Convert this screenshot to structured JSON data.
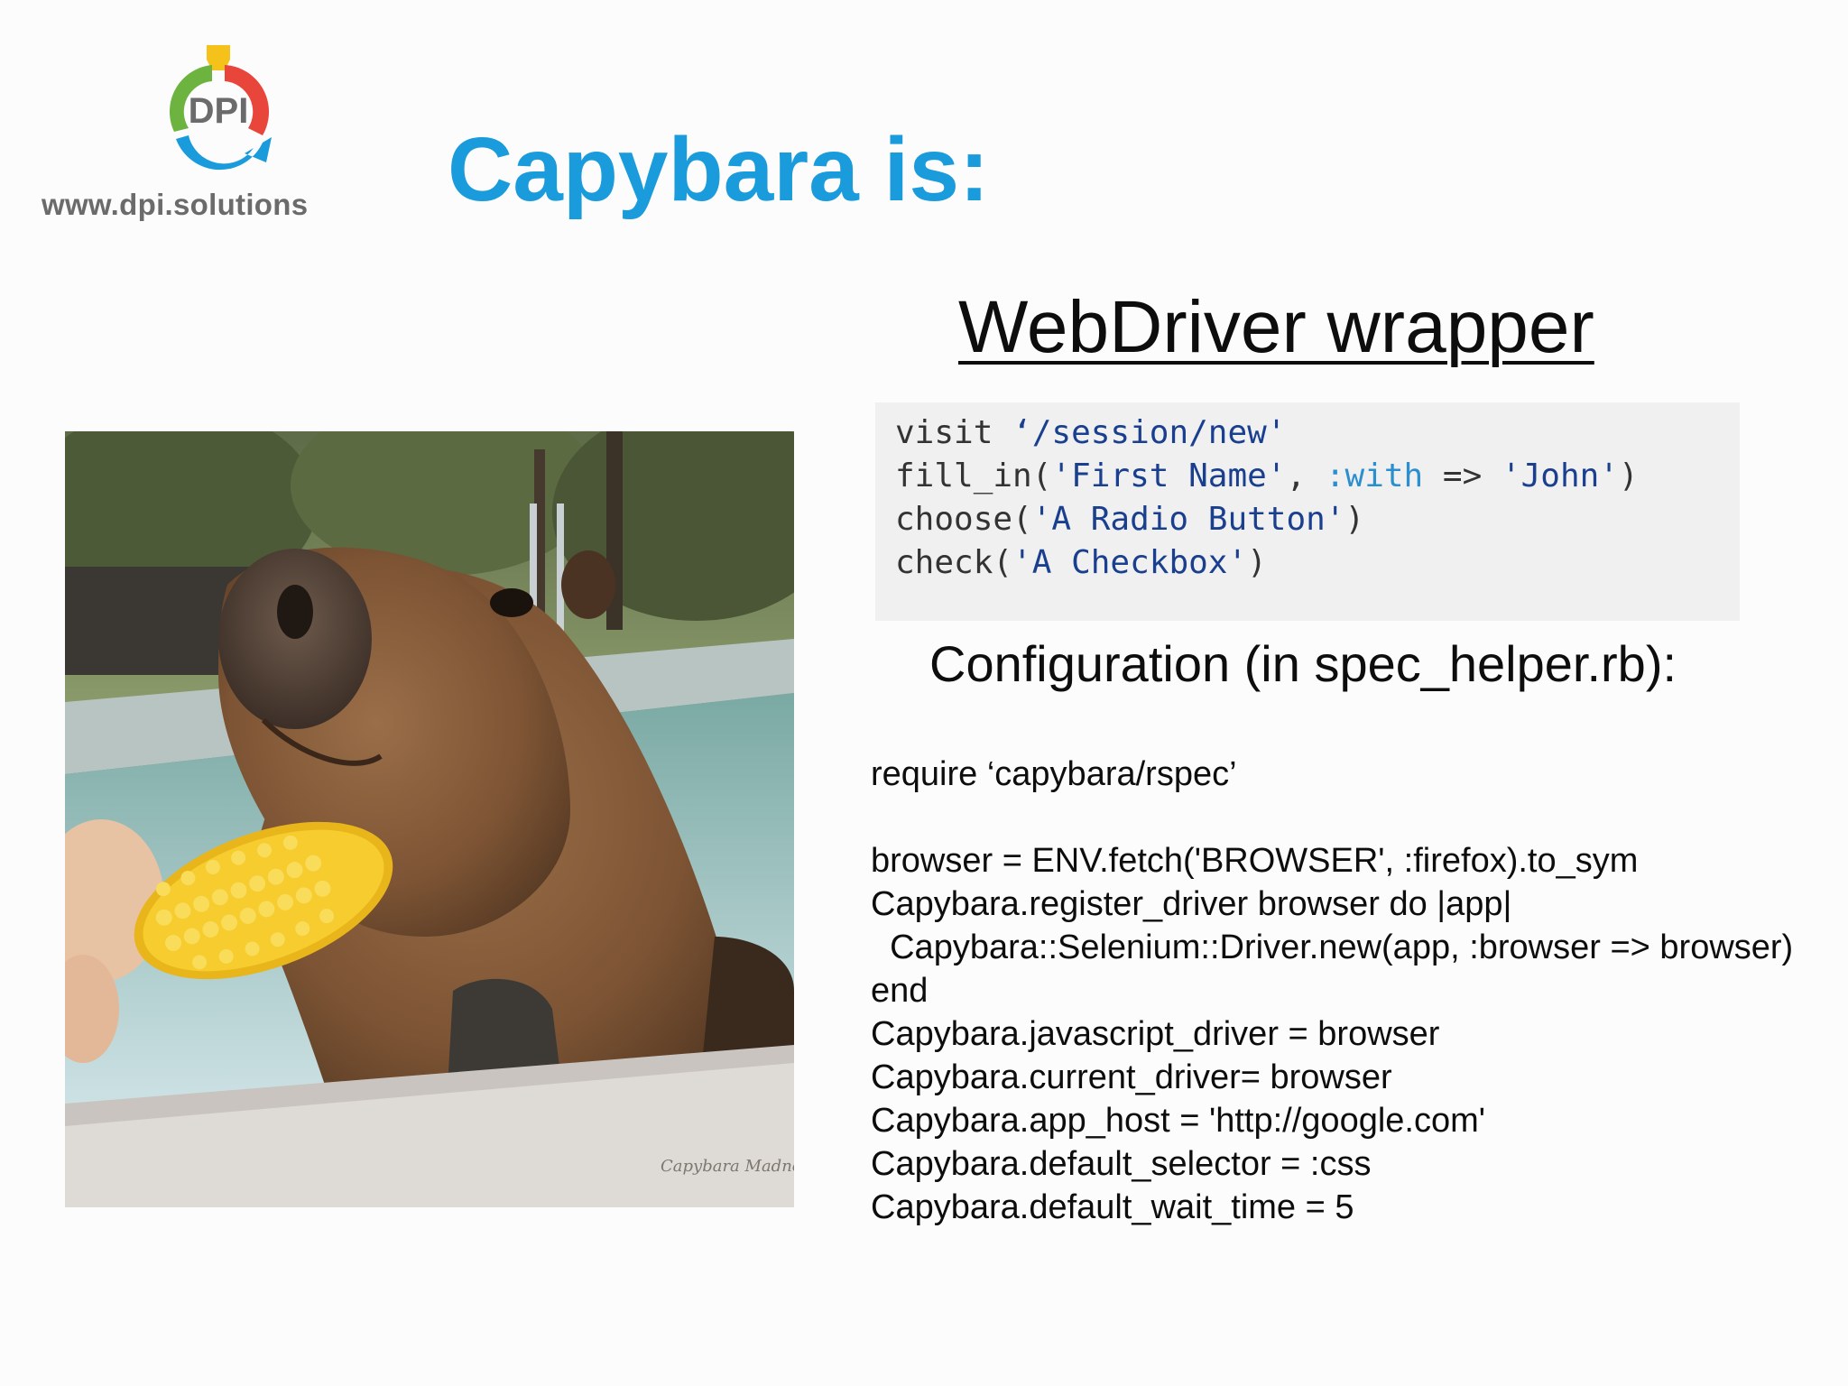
{
  "logo": {
    "mark_text": "DPI",
    "url": "www.dpi.solutions",
    "colors": {
      "green": "#6cb33f",
      "red": "#e8463a",
      "yellow": "#f4c21b",
      "blue": "#1a9bdb",
      "gray": "#6b6b6b"
    }
  },
  "title": "Capybara is:",
  "title_color": "#1a9bdb",
  "subtitle": "WebDriver wrapper",
  "code_example": {
    "lines": [
      {
        "plain1": "visit ",
        "str1": "‘/session/new'",
        "plain2": "",
        "sym": "",
        "plain3": "",
        "str2": "",
        "plain4": ""
      },
      {
        "plain1": "fill_in(",
        "str1": "'First Name'",
        "plain2": ", ",
        "sym": ":with",
        "plain3": " => ",
        "str2": "'John'",
        "plain4": ")"
      },
      {
        "plain1": "choose(",
        "str1": "'A Radio Button'",
        "plain2": ")",
        "sym": "",
        "plain3": "",
        "str2": "",
        "plain4": ""
      },
      {
        "plain1": "check(",
        "str1": "'A Checkbox'",
        "plain2": ")",
        "sym": "",
        "plain3": "",
        "str2": "",
        "plain4": ""
      }
    ]
  },
  "config_heading": "Configuration (in spec_helper.rb):",
  "config_code": [
    "require ‘capybara/rspec’",
    "",
    "browser = ENV.fetch('BROWSER', :firefox).to_sym",
    "Capybara.register_driver browser do |app|",
    "  Capybara::Selenium::Driver.new(app, :browser => browser)",
    "end",
    "Capybara.javascript_driver = browser",
    "Capybara.current_driver= browser",
    "Capybara.app_host = 'http://google.com'",
    "Capybara.default_selector = :css",
    "Capybara.default_wait_time = 5"
  ],
  "photo": {
    "subject": "capybara eating corn cob",
    "watermark": "Capybara Madness"
  }
}
